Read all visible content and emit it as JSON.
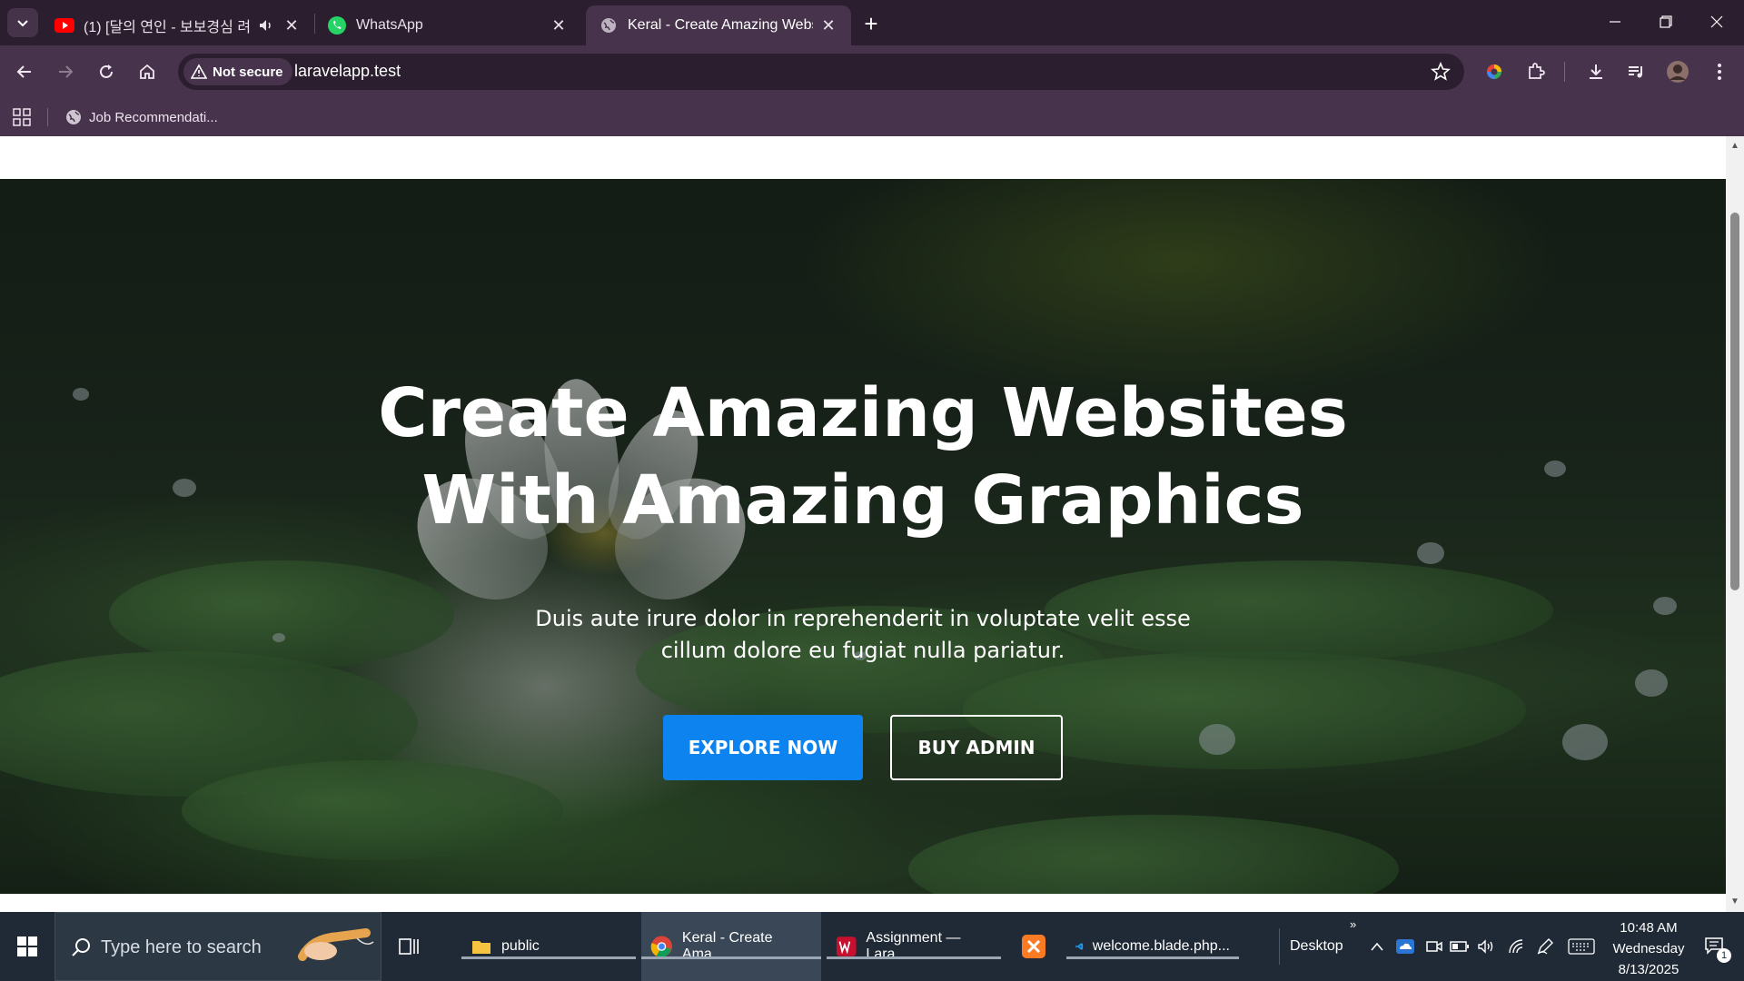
{
  "browser": {
    "tabs": [
      {
        "title": "(1) [달의 연인 - 보보경심 려",
        "favicon": "youtube-icon",
        "audio": true,
        "active": false
      },
      {
        "title": "WhatsApp",
        "favicon": "whatsapp-icon",
        "active": false
      },
      {
        "title": "Keral - Create Amazing Website",
        "favicon": "globe-icon",
        "active": true
      }
    ],
    "security_label": "Not secure",
    "url": "laravelapp.test",
    "bookmarks": [
      {
        "label": "Job Recommendati...",
        "icon": "globe-icon"
      }
    ],
    "colors": {
      "frame": "#2b1e2e",
      "toolbar": "#47344c"
    }
  },
  "hero": {
    "title_line1": "Create Amazing Websites",
    "title_line2": "With Amazing Graphics",
    "subtitle_line1": "Duis aute irure dolor in reprehenderit in voluptate velit esse",
    "subtitle_line2": "cillum dolore eu fugiat nulla pariatur.",
    "primary_button": "EXPLORE NOW",
    "secondary_button": "BUY ADMIN",
    "colors": {
      "primary": "#0d83f0"
    }
  },
  "taskbar": {
    "search_placeholder": "Type here to search",
    "apps": [
      {
        "label": "public",
        "icon": "folder-icon"
      },
      {
        "label": "Keral - Create Ama...",
        "icon": "chrome-icon",
        "active": true
      },
      {
        "label": "Assignment — Lara...",
        "icon": "wps-icon"
      },
      {
        "label": "",
        "icon": "xampp-icon"
      },
      {
        "label": "welcome.blade.php...",
        "icon": "vscode-icon"
      }
    ],
    "desktop_label": "Desktop",
    "time": "10:48 AM",
    "day": "Wednesday",
    "date": "8/13/2025",
    "notification_count": "1"
  }
}
